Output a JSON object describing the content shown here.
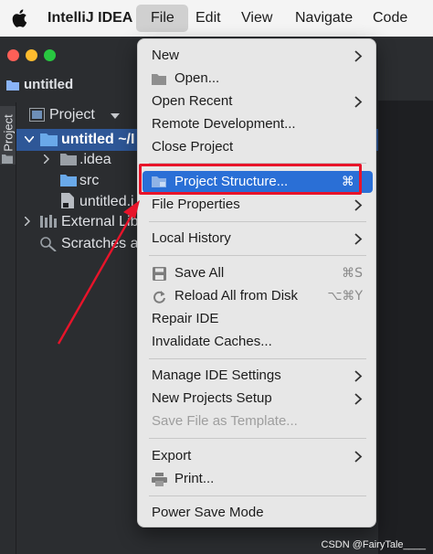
{
  "menubar": {
    "app_name": "IntelliJ IDEA",
    "items": [
      "File",
      "Edit",
      "View",
      "Navigate",
      "Code"
    ]
  },
  "window": {
    "project_title": "untitled"
  },
  "sidebar": {
    "tab_label": "Project"
  },
  "project_panel": {
    "title": "Project",
    "tree": [
      {
        "label": "untitled ~/I",
        "level": 0
      },
      {
        "label": ".idea",
        "level": 1
      },
      {
        "label": "src",
        "level": 1
      },
      {
        "label": "untitled.i",
        "level": 1
      },
      {
        "label": "External Lib",
        "level": 0
      },
      {
        "label": "Scratches a",
        "level": 0
      }
    ]
  },
  "file_menu": {
    "items": {
      "new": "New",
      "open": "Open...",
      "open_recent": "Open Recent",
      "remote_development": "Remote Development...",
      "close_project": "Close Project",
      "project_structure": "Project Structure...",
      "project_structure_shortcut": "⌘ ;",
      "file_properties": "File Properties",
      "local_history": "Local History",
      "save_all": "Save All",
      "save_all_shortcut": "⌘S",
      "reload_all": "Reload All from Disk",
      "reload_all_shortcut": "⌥⌘Y",
      "repair_ide": "Repair IDE",
      "invalidate_caches": "Invalidate Caches...",
      "manage_ide_settings": "Manage IDE Settings",
      "new_projects_setup": "New Projects Setup",
      "save_file_as_template": "Save File as Template...",
      "export": "Export",
      "print": "Print...",
      "power_save_mode": "Power Save Mode"
    }
  },
  "watermark": "CSDN @FairyTale____",
  "colors": {
    "highlight": "#2a6fd6",
    "annotation_red": "#e8142a",
    "ide_background": "#2b2d30"
  }
}
